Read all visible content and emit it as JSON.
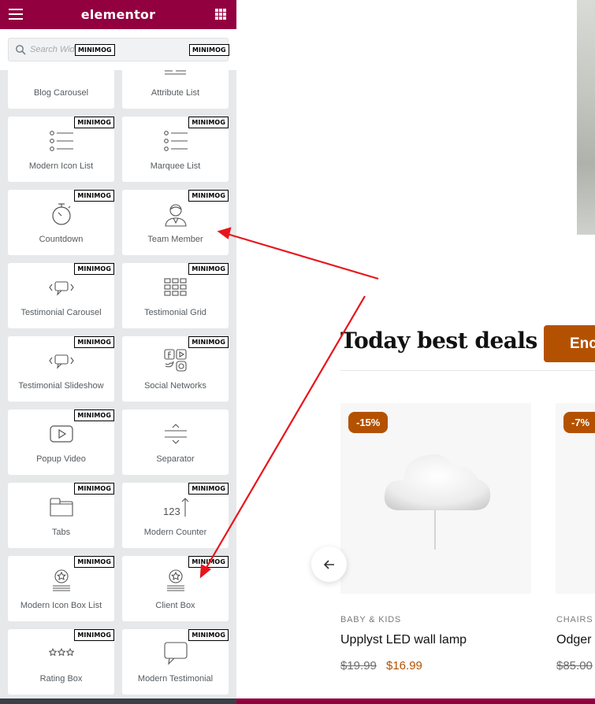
{
  "panel": {
    "logo": "elementor",
    "search_placeholder": "Search Widget...",
    "badge_text": "MINIMOG",
    "widgets": [
      {
        "label": "Blog Carousel",
        "icon": "blog-carousel-icon"
      },
      {
        "label": "Attribute List",
        "icon": "attribute-list-icon"
      },
      {
        "label": "Modern Icon List",
        "icon": "icon-list-icon"
      },
      {
        "label": "Marquee List",
        "icon": "marquee-list-icon"
      },
      {
        "label": "Countdown",
        "icon": "stopwatch-icon"
      },
      {
        "label": "Team Member",
        "icon": "team-member-icon"
      },
      {
        "label": "Testimonial Carousel",
        "icon": "testimonial-carousel-icon"
      },
      {
        "label": "Testimonial Grid",
        "icon": "grid-icon"
      },
      {
        "label": "Testimonial Slideshow",
        "icon": "testimonial-slideshow-icon"
      },
      {
        "label": "Social Networks",
        "icon": "social-networks-icon"
      },
      {
        "label": "Popup Video",
        "icon": "video-play-icon"
      },
      {
        "label": "Separator",
        "icon": "separator-icon"
      },
      {
        "label": "Tabs",
        "icon": "tabs-icon"
      },
      {
        "label": "Modern Counter",
        "icon": "counter-icon"
      },
      {
        "label": "Modern Icon Box List",
        "icon": "icon-box-list-icon"
      },
      {
        "label": "Client Box",
        "icon": "client-box-icon"
      },
      {
        "label": "Rating Box",
        "icon": "rating-stars-icon"
      },
      {
        "label": "Modern Testimonial",
        "icon": "speech-bubble-icon"
      }
    ]
  },
  "page": {
    "section_title": "Today best deals",
    "cta_label": "Enc",
    "products": [
      {
        "discount": "-15%",
        "category": "BABY & KIDS",
        "name": "Upplyst LED wall lamp",
        "old_price": "$19.99",
        "new_price": "$16.99"
      },
      {
        "discount": "-7%",
        "category": "CHAIRS",
        "name": "Odger",
        "old_price": "$85.00",
        "new_price": ""
      }
    ]
  },
  "colors": {
    "brand": "#93003f",
    "accent": "#b45100",
    "arrow": "#e8141b"
  }
}
